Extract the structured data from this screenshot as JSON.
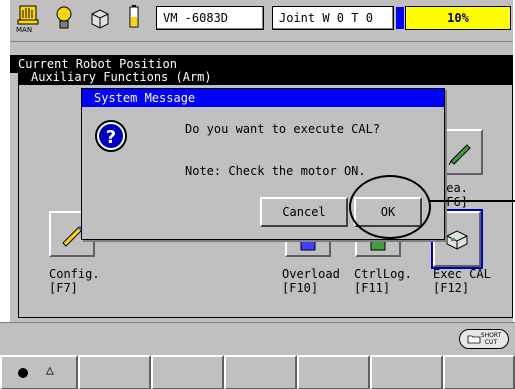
{
  "status": {
    "mode_label": "MAN",
    "robot_model": "VM -6083D",
    "coord": "Joint",
    "flags": "W 0 T 0",
    "speed": "10%"
  },
  "screen_title": "Current Robot Position",
  "panel_title": "Auxiliary Functions (Arm)",
  "function_buttons": [
    {
      "label": "Config.",
      "key": "[F7]"
    },
    {
      "label": "Overload",
      "key": "[F10]"
    },
    {
      "label": "CtrlLog.",
      "key": "[F11]"
    },
    {
      "label": "Exec CAL",
      "key": "[F12]"
    },
    {
      "label": "rea.",
      "key": "[F6]"
    }
  ],
  "dialog": {
    "title": "System Message",
    "question": "Do you want to execute CAL?",
    "note": "Note: Check the motor ON.",
    "cancel_label": "Cancel",
    "ok_label": "OK"
  },
  "shortcut": {
    "line1": "SHORT",
    "line2": "CUT"
  },
  "softkeys": {
    "count": 7
  }
}
